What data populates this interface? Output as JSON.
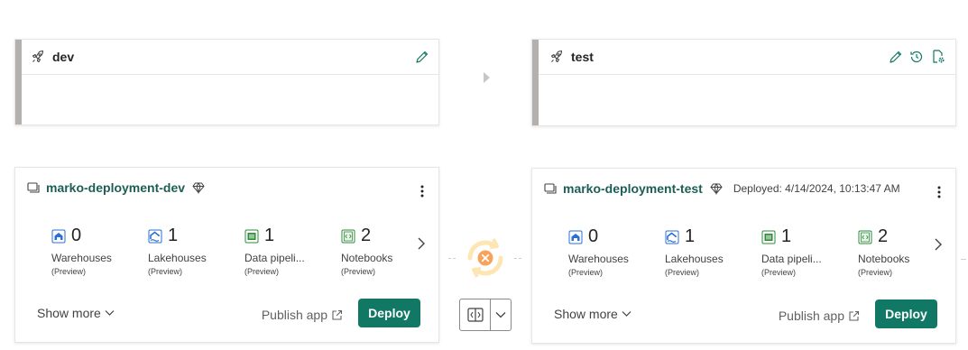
{
  "stages": [
    {
      "name": "dev",
      "icons": [
        "rocket-icon",
        "pencil-icon"
      ]
    },
    {
      "name": "test",
      "icons": [
        "rocket-icon",
        "pencil-icon",
        "history-icon",
        "settings-doc-icon"
      ]
    }
  ],
  "workspaces": [
    {
      "name": "marko-deployment-dev",
      "deployed": "",
      "items": [
        {
          "count": "0",
          "label": "Warehouses",
          "sub": "(Preview)",
          "icon": "warehouse-icon"
        },
        {
          "count": "1",
          "label": "Lakehouses",
          "sub": "(Preview)",
          "icon": "lakehouse-icon"
        },
        {
          "count": "1",
          "label": "Data pipeli...",
          "sub": "(Preview)",
          "icon": "pipeline-icon"
        },
        {
          "count": "2",
          "label": "Notebooks",
          "sub": "(Preview)",
          "icon": "notebook-icon"
        }
      ],
      "show_more": "Show more",
      "publish": "Publish app",
      "deploy": "Deploy"
    },
    {
      "name": "marko-deployment-test",
      "deployed": "Deployed: 4/14/2024, 10:13:47 AM",
      "items": [
        {
          "count": "0",
          "label": "Warehouses",
          "sub": "(Preview)",
          "icon": "warehouse-icon"
        },
        {
          "count": "1",
          "label": "Lakehouses",
          "sub": "(Preview)",
          "icon": "lakehouse-icon"
        },
        {
          "count": "1",
          "label": "Data pipeli...",
          "sub": "(Preview)",
          "icon": "pipeline-icon"
        },
        {
          "count": "2",
          "label": "Notebooks",
          "sub": "(Preview)",
          "icon": "notebook-icon"
        }
      ],
      "show_more": "Show more",
      "publish": "Publish app",
      "deploy": "Deploy"
    }
  ],
  "colors": {
    "accent": "#117865",
    "workspace_name": "#1c5e55",
    "stage_bar": "#b3b0ad",
    "sync_ring": "#fde6b3",
    "sync_error": "#f7a35c"
  }
}
